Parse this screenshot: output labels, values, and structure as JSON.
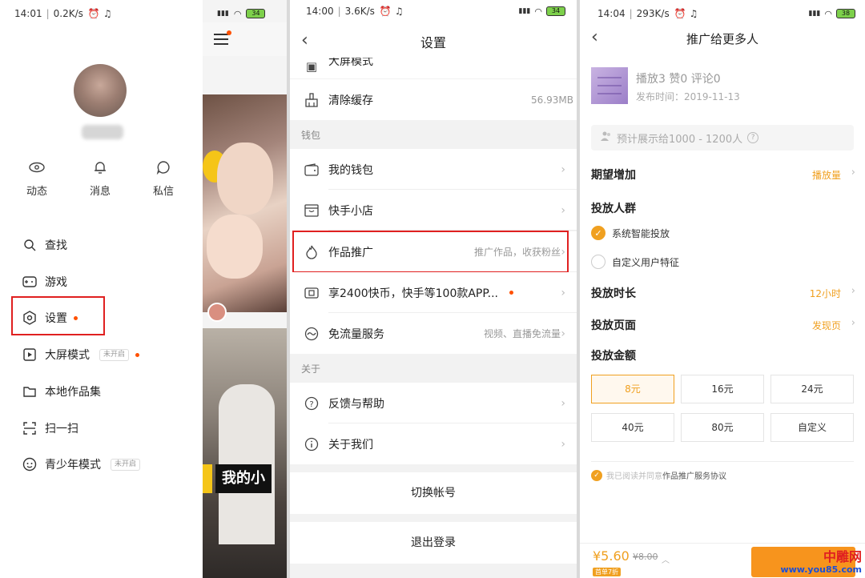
{
  "panel1": {
    "status": {
      "time": "14:01",
      "speed": "0.2K/s",
      "battery": "34"
    },
    "quick_actions": [
      {
        "icon": "eye-icon",
        "label": "动态"
      },
      {
        "icon": "bell-icon",
        "label": "消息"
      },
      {
        "icon": "chat-bubble-icon",
        "label": "私信"
      }
    ],
    "menu": [
      {
        "icon": "search-icon",
        "label": "查找"
      },
      {
        "icon": "gamepad-icon",
        "label": "游戏"
      },
      {
        "icon": "settings-hexagon-icon",
        "label": "设置"
      },
      {
        "icon": "play-square-icon",
        "label": "大屏模式",
        "tag": "未开启"
      },
      {
        "icon": "folder-icon",
        "label": "本地作品集"
      },
      {
        "icon": "scan-icon",
        "label": "扫一扫"
      },
      {
        "icon": "smiley-icon",
        "label": "青少年模式",
        "tag": "未开启"
      }
    ],
    "feed_caption": "我的小"
  },
  "panel2": {
    "status": {
      "time": "14:00",
      "speed": "3.6K/s",
      "battery": "34"
    },
    "title": "设置",
    "rows": {
      "bigscreen": "大屏模式",
      "clear_cache": {
        "label": "清除缓存",
        "value": "56.93MB"
      },
      "wallet_section": "钱包",
      "my_wallet": "我的钱包",
      "shop": "快手小店",
      "promote": {
        "label": "作品推广",
        "value": "推广作品，收获粉丝"
      },
      "coins": "享2400快币，快手等100款APP...",
      "free_data": {
        "label": "免流量服务",
        "value": "视频、直播免流量"
      },
      "about_section": "关于",
      "feedback": "反馈与帮助",
      "about_us": "关于我们"
    },
    "switch_account": "切换帐号",
    "logout": "退出登录"
  },
  "panel3": {
    "status": {
      "time": "14:04",
      "speed": "293K/s",
      "battery": "38"
    },
    "title": "推广给更多人",
    "stats": "播放3  赞0  评论0",
    "publish_date": "发布时间：2019-11-13",
    "estimate": "预计展示给1000 - 1200人",
    "expect_label": "期望增加",
    "expect_value": "播放量",
    "audience_label": "投放人群",
    "audience_options": [
      "系统智能投放",
      "自定义用户特征"
    ],
    "duration_label": "投放时长",
    "duration_value": "12小时",
    "page_label": "投放页面",
    "page_value": "发现页",
    "amount_label": "投放金额",
    "amounts": [
      "8元",
      "16元",
      "24元",
      "40元",
      "80元",
      "自定义"
    ],
    "agree_prefix": "我已阅读并同意",
    "agree_link": "作品推广服务协议",
    "price": "¥5.60",
    "old_price": "¥8.00",
    "discount": "首单7折",
    "watermark_1": "中雕网",
    "watermark_2": "www.you85.com"
  }
}
